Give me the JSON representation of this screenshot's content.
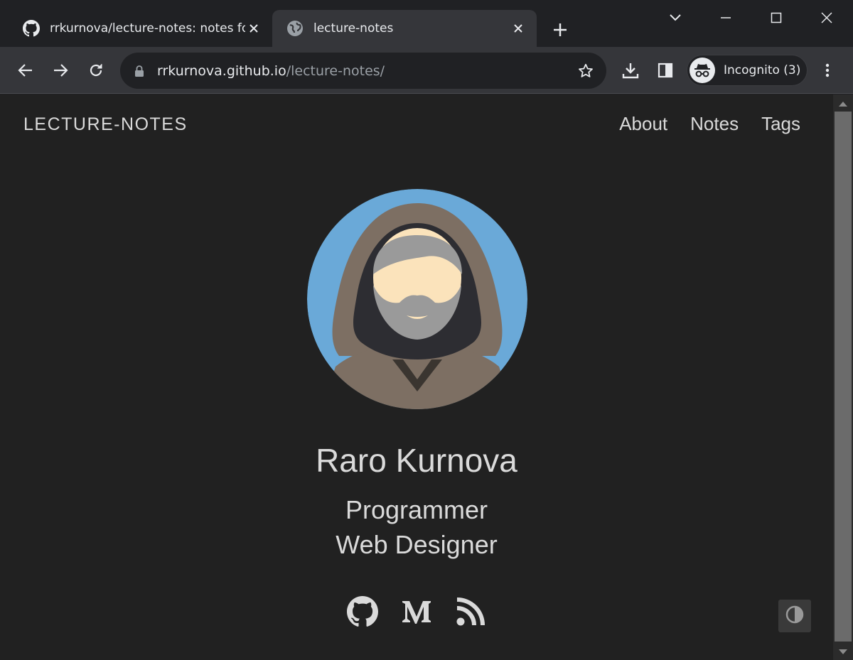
{
  "browser": {
    "tabs": [
      {
        "title": "rrkurnova/lecture-notes: notes fo",
        "icon": "github-icon",
        "active": false
      },
      {
        "title": "lecture-notes",
        "icon": "globe-icon",
        "active": true
      }
    ],
    "omnibox": {
      "host": "rrkurnova.github.io",
      "path": "/lecture-notes/"
    },
    "profile_label": "Incognito (3)"
  },
  "site": {
    "title": "LECTURE-NOTES",
    "nav": [
      "About",
      "Notes",
      "Tags"
    ],
    "name": "Raro Kurnova",
    "roles": [
      "Programmer",
      "Web Designer"
    ],
    "socials": [
      "github-icon",
      "medium-icon",
      "rss-icon"
    ]
  },
  "colors": {
    "page_bg": "#212121",
    "browser_bg": "#202124",
    "toolbar_bg": "#35363a",
    "text": "#dadada",
    "avatar_bg": "#6aa9d8"
  }
}
